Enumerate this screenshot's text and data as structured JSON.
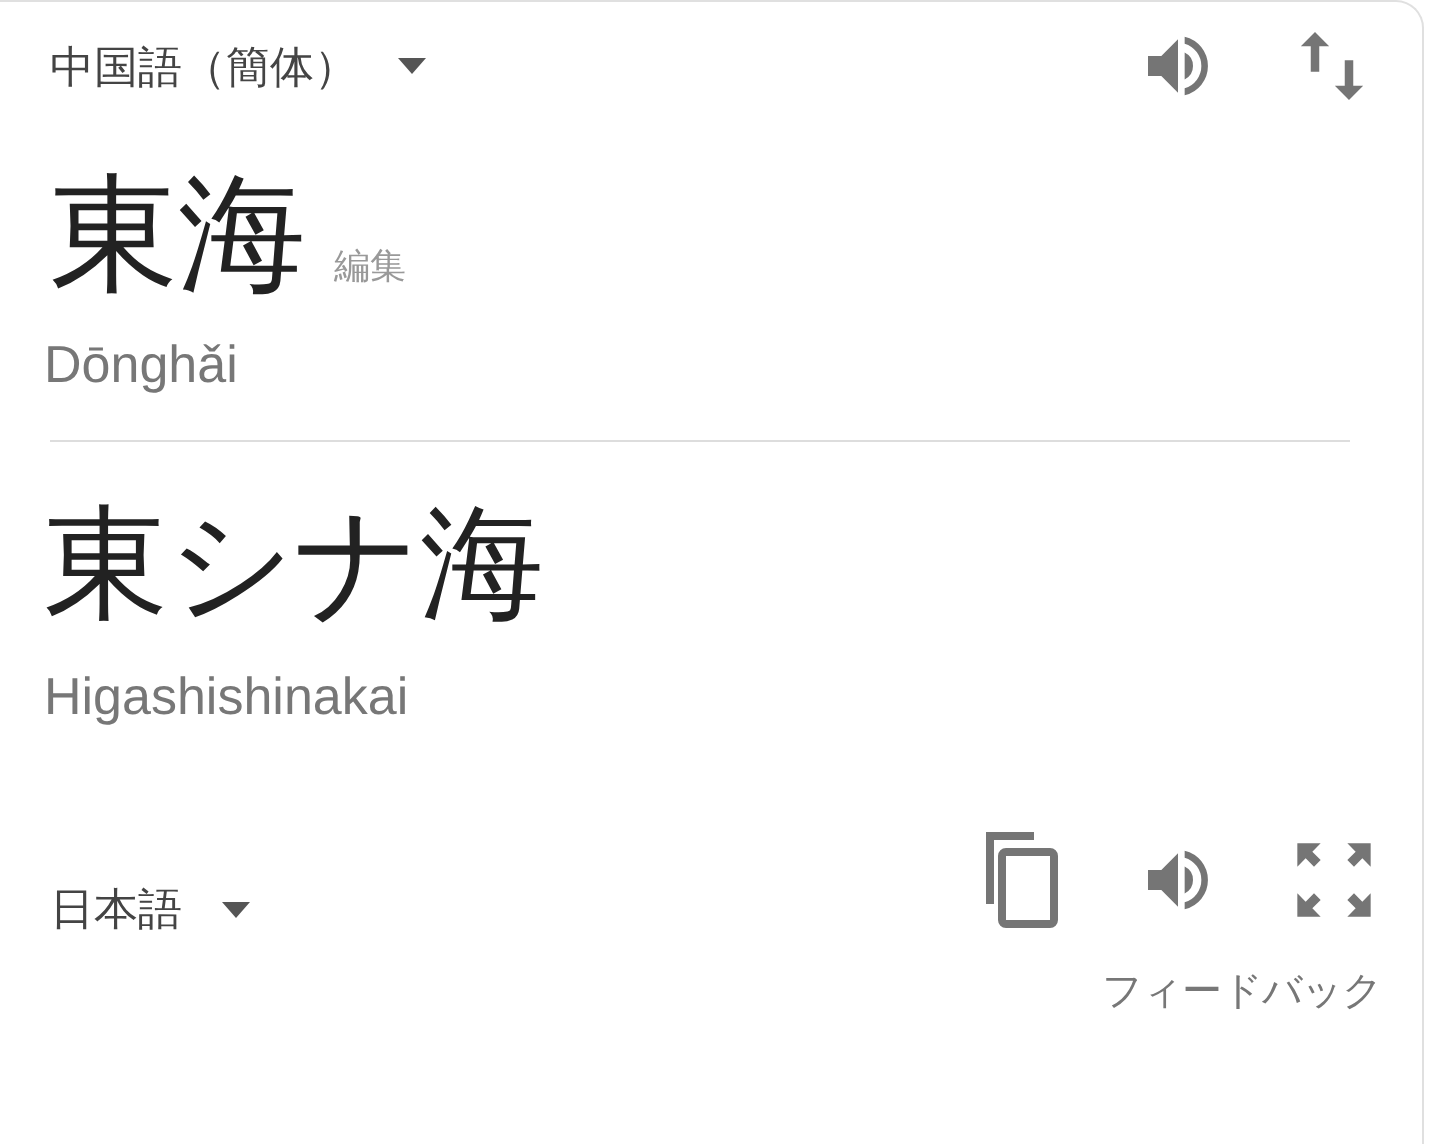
{
  "source": {
    "language": "中国語（簡体）",
    "text": "東海",
    "edit_link": "編集",
    "romanization": "Dōnghǎi"
  },
  "target": {
    "text": "東シナ海",
    "romanization": "Higashishinakai",
    "language": "日本語"
  },
  "feedback_link": "フィードバック"
}
